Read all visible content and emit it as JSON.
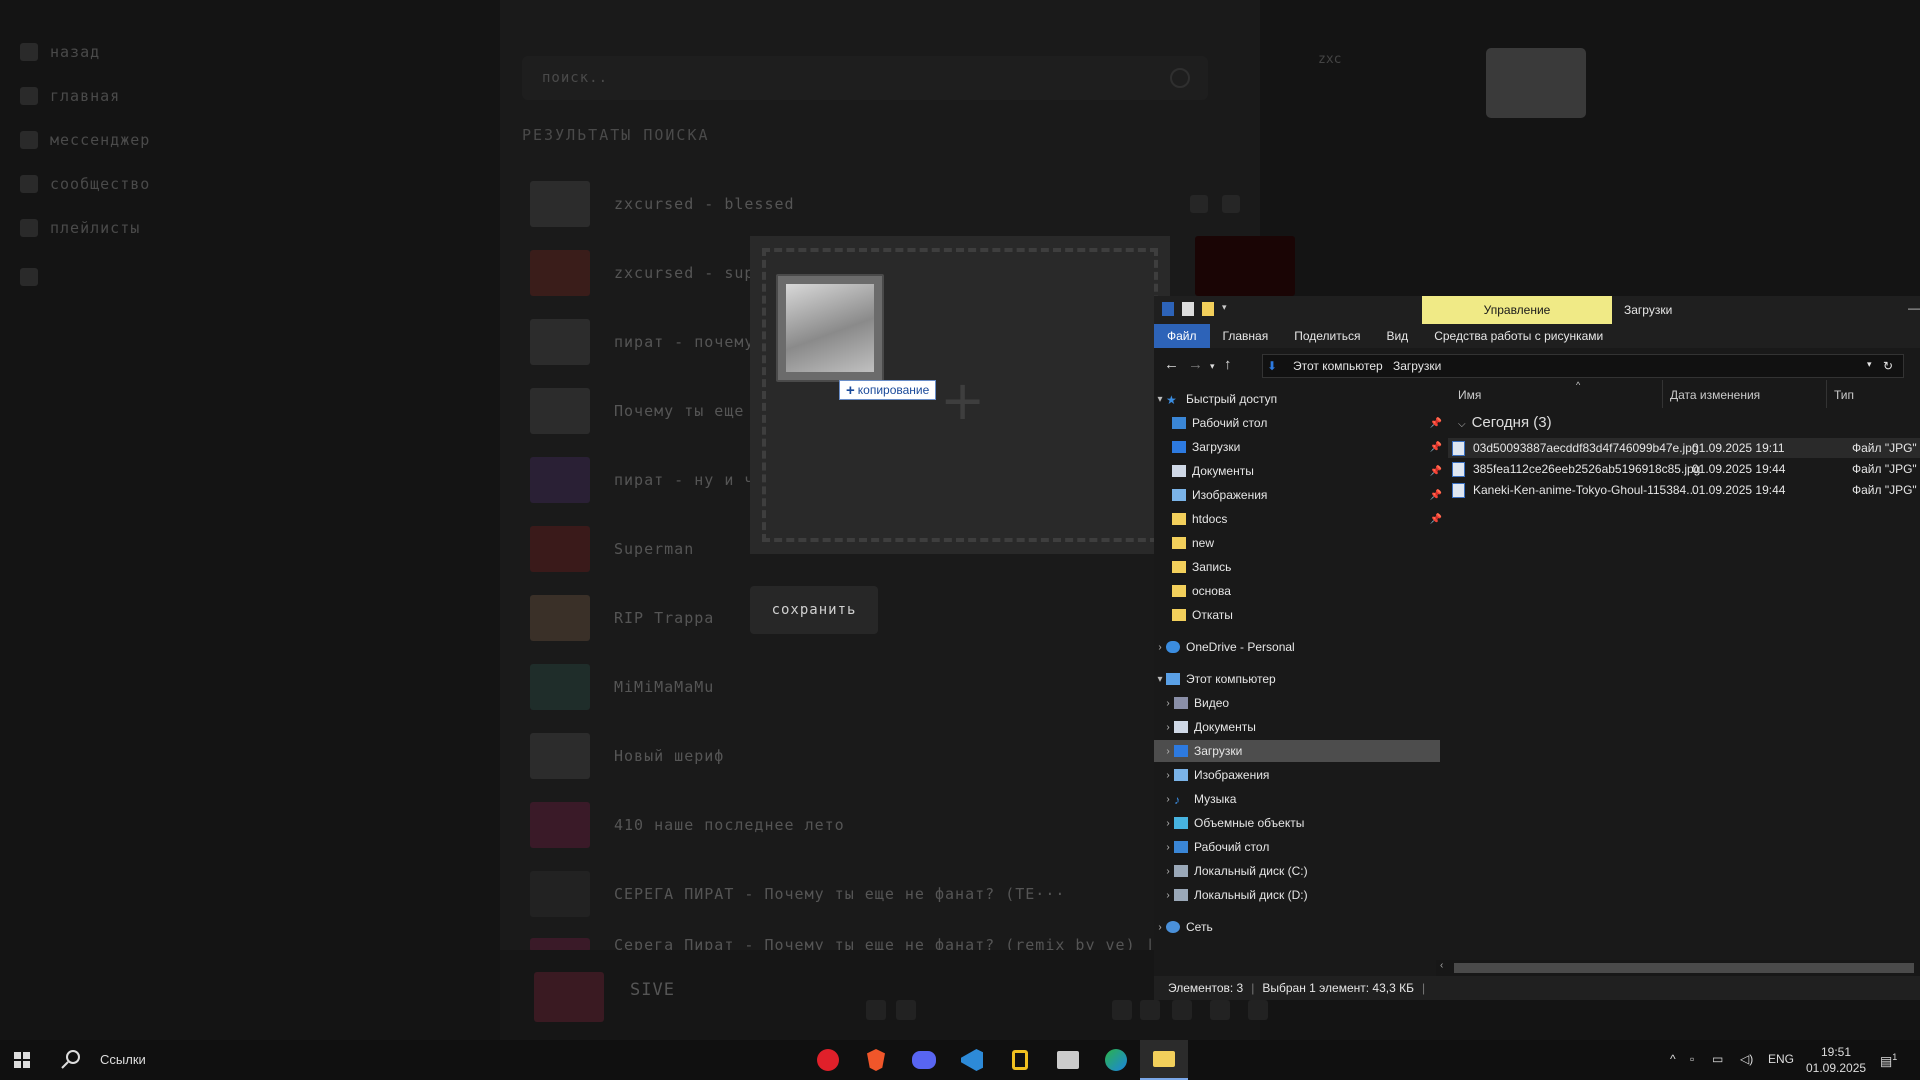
{
  "sidebar": {
    "items": [
      {
        "label": "назад",
        "icon": "back-icon"
      },
      {
        "label": "главная",
        "icon": "home-icon"
      },
      {
        "label": "мессенджер",
        "icon": "chat-icon"
      },
      {
        "label": "сообщество",
        "icon": "community-icon"
      },
      {
        "label": "плейлисты",
        "icon": "playlist-icon"
      }
    ]
  },
  "search": {
    "placeholder": "поиск.."
  },
  "results_title": "РЕЗУЛЬТАТЫ ПОИСКА",
  "tracks": [
    "zxcursed - blessed",
    "zxcursed - supern",
    "пират - почему ты",
    "Почему ты еще не",
    "пират - ну и что ч",
    "Superman",
    "RIP Trappa",
    "MiMiMaMaMu",
    "Новый шериф",
    "410 наше последнее лето",
    "СЕРЕГА ПИРАТ - Почему ты еще не фанат? (TE···",
    "Серега Пират - Почему ты еще не фанат? (remix by ve) | ba..."
  ],
  "user": {
    "name": "zxc"
  },
  "player": {
    "track": "SIVE"
  },
  "upload": {
    "drag_tip": "копирование",
    "save_label": "сохранить"
  },
  "explorer": {
    "manage_label": "Управление",
    "window_title": "Загрузки",
    "ribbon": [
      "Файл",
      "Главная",
      "Поделиться",
      "Вид",
      "Средства работы с рисунками"
    ],
    "breadcrumb": [
      "Этот компьютер",
      "Загрузки"
    ],
    "quick_access": "Быстрый доступ",
    "quick_items": [
      "Рабочий стол",
      "Загрузки",
      "Документы",
      "Изображения",
      "htdocs",
      "new",
      "Запись",
      "основа",
      "Откаты"
    ],
    "onedrive": "OneDrive - Personal",
    "this_pc": "Этот компьютер",
    "pc_items": [
      "Видео",
      "Документы",
      "Загрузки",
      "Изображения",
      "Музыка",
      "Объемные объекты",
      "Рабочий стол",
      "Локальный диск (C:)",
      "Локальный диск (D:)"
    ],
    "network": "Сеть",
    "columns": {
      "name": "Имя",
      "date": "Дата изменения",
      "type": "Тип"
    },
    "group": "Сегодня (3)",
    "files": [
      {
        "name": "03d50093887aecddf83d4f746099b47e.jpg",
        "date": "01.09.2025 19:11",
        "type": "Файл \"JPG\""
      },
      {
        "name": "385fea112ce26eeb2526ab5196918c85.jpg",
        "date": "01.09.2025 19:44",
        "type": "Файл \"JPG\""
      },
      {
        "name": "Kaneki-Ken-anime-Tokyo-Ghoul-115384...",
        "date": "01.09.2025 19:44",
        "type": "Файл \"JPG\""
      }
    ],
    "status": {
      "count": "Элементов: 3",
      "selected": "Выбран 1 элемент: 43,3 КБ"
    }
  },
  "taskbar": {
    "search_label": "Ссылки",
    "apps": [
      "mts-icon",
      "brave-icon",
      "discord-icon",
      "vscode-icon",
      "lock-app-icon",
      "media-app-icon",
      "edge-icon",
      "explorer-icon"
    ],
    "lang": "ENG",
    "time": "19:51",
    "date": "01.09.2025",
    "notifications": "1"
  }
}
